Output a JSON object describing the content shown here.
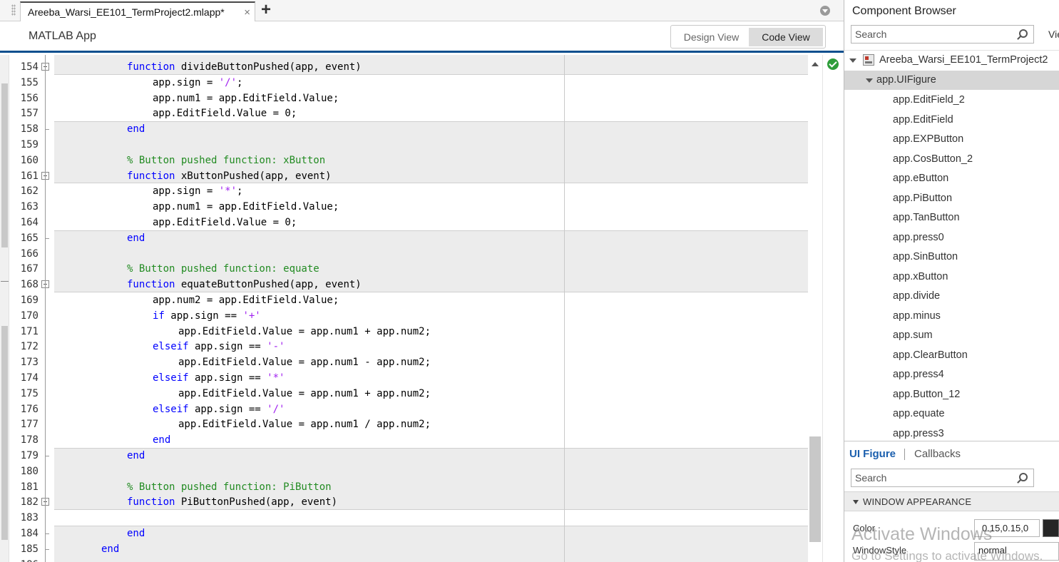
{
  "editor_tab": {
    "file_name": "Areeba_Warsi_EE101_TermProject2.mlapp*",
    "close_glyph": "×",
    "add_glyph": "+"
  },
  "app_header": {
    "title": "MATLAB App",
    "design_view_label": "Design View",
    "code_view_label": "Code View"
  },
  "code_lines": [
    {
      "n": "154",
      "indent": 8,
      "tokens": [
        [
          "kw",
          "function"
        ],
        [
          "",
          "divideButtonPushed(app, event)"
        ]
      ],
      "fold": "start"
    },
    {
      "n": "155",
      "indent": 12,
      "tokens": [
        [
          "",
          "app.sign = "
        ],
        [
          "st",
          "'/'"
        ],
        [
          "",
          ";"
        ]
      ]
    },
    {
      "n": "156",
      "indent": 12,
      "tokens": [
        [
          "",
          "app.num1 = app.EditField.Value;"
        ]
      ]
    },
    {
      "n": "157",
      "indent": 12,
      "tokens": [
        [
          "",
          "app.EditField.Value = 0;"
        ]
      ]
    },
    {
      "n": "158",
      "indent": 8,
      "tokens": [
        [
          "kw",
          "end"
        ]
      ],
      "fold": "end"
    },
    {
      "n": "159",
      "indent": 0,
      "tokens": []
    },
    {
      "n": "160",
      "indent": 8,
      "tokens": [
        [
          "cm",
          "% Button pushed function: xButton"
        ]
      ]
    },
    {
      "n": "161",
      "indent": 8,
      "tokens": [
        [
          "kw",
          "function"
        ],
        [
          "",
          "xButtonPushed(app, event)"
        ]
      ],
      "fold": "start"
    },
    {
      "n": "162",
      "indent": 12,
      "tokens": [
        [
          "",
          "app.sign = "
        ],
        [
          "st",
          "'*'"
        ],
        [
          "",
          ";"
        ]
      ]
    },
    {
      "n": "163",
      "indent": 12,
      "tokens": [
        [
          "",
          "app.num1 = app.EditField.Value;"
        ]
      ]
    },
    {
      "n": "164",
      "indent": 12,
      "tokens": [
        [
          "",
          "app.EditField.Value = 0;"
        ]
      ]
    },
    {
      "n": "165",
      "indent": 8,
      "tokens": [
        [
          "kw",
          "end"
        ]
      ],
      "fold": "end"
    },
    {
      "n": "166",
      "indent": 0,
      "tokens": []
    },
    {
      "n": "167",
      "indent": 8,
      "tokens": [
        [
          "cm",
          "% Button pushed function: equate"
        ]
      ]
    },
    {
      "n": "168",
      "indent": 8,
      "tokens": [
        [
          "kw",
          "function"
        ],
        [
          "",
          "equateButtonPushed(app, event)"
        ]
      ],
      "fold": "start"
    },
    {
      "n": "169",
      "indent": 12,
      "tokens": [
        [
          "",
          "app.num2 = app.EditField.Value;"
        ]
      ]
    },
    {
      "n": "170",
      "indent": 12,
      "tokens": [
        [
          "kw",
          "if"
        ],
        [
          "",
          "app.sign == "
        ],
        [
          "st",
          "'+'"
        ]
      ]
    },
    {
      "n": "171",
      "indent": 16,
      "tokens": [
        [
          "",
          "app.EditField.Value = app.num1 + app.num2;"
        ]
      ]
    },
    {
      "n": "172",
      "indent": 12,
      "tokens": [
        [
          "kw",
          "elseif"
        ],
        [
          "",
          "app.sign == "
        ],
        [
          "st",
          "'-'"
        ]
      ]
    },
    {
      "n": "173",
      "indent": 16,
      "tokens": [
        [
          "",
          "app.EditField.Value = app.num1 - app.num2;"
        ]
      ]
    },
    {
      "n": "174",
      "indent": 12,
      "tokens": [
        [
          "kw",
          "elseif"
        ],
        [
          "",
          "app.sign == "
        ],
        [
          "st",
          "'*'"
        ]
      ]
    },
    {
      "n": "175",
      "indent": 16,
      "tokens": [
        [
          "",
          "app.EditField.Value = app.num1 + app.num2;"
        ]
      ]
    },
    {
      "n": "176",
      "indent": 12,
      "tokens": [
        [
          "kw",
          "elseif"
        ],
        [
          "",
          "app.sign == "
        ],
        [
          "st",
          "'/'"
        ]
      ]
    },
    {
      "n": "177",
      "indent": 16,
      "tokens": [
        [
          "",
          "app.EditField.Value = app.num1 / app.num2;"
        ]
      ]
    },
    {
      "n": "178",
      "indent": 12,
      "tokens": [
        [
          "kw",
          "end"
        ]
      ]
    },
    {
      "n": "179",
      "indent": 8,
      "tokens": [
        [
          "kw",
          "end"
        ]
      ],
      "fold": "end"
    },
    {
      "n": "180",
      "indent": 0,
      "tokens": []
    },
    {
      "n": "181",
      "indent": 8,
      "tokens": [
        [
          "cm",
          "% Button pushed function: PiButton"
        ]
      ]
    },
    {
      "n": "182",
      "indent": 8,
      "tokens": [
        [
          "kw",
          "function"
        ],
        [
          "",
          "PiButtonPushed(app, event)"
        ]
      ],
      "fold": "start"
    },
    {
      "n": "183",
      "indent": 0,
      "tokens": []
    },
    {
      "n": "184",
      "indent": 8,
      "tokens": [
        [
          "kw",
          "end"
        ]
      ],
      "fold": "end"
    },
    {
      "n": "185",
      "indent": 4,
      "tokens": [
        [
          "kw",
          "end"
        ]
      ],
      "fold": "end"
    },
    {
      "n": "186",
      "indent": 0,
      "tokens": []
    }
  ],
  "component_browser": {
    "title": "Component Browser",
    "search_placeholder": "Search",
    "view_cut_label": "Vie",
    "root": "Areeba_Warsi_EE101_TermProject2",
    "figure": "app.UIFigure",
    "components": [
      "app.EditField_2",
      "app.EditField",
      "app.EXPButton",
      "app.CosButton_2",
      "app.eButton",
      "app.PiButton",
      "app.TanButton",
      "app.press0",
      "app.SinButton",
      "app.xButton",
      "app.divide",
      "app.minus",
      "app.sum",
      "app.ClearButton",
      "app.press4",
      "app.Button_12",
      "app.equate",
      "app.press3"
    ]
  },
  "inspector": {
    "tab_ui_figure": "UI Figure",
    "tab_callbacks": "Callbacks",
    "search_placeholder": "Search",
    "section_title": "WINDOW APPEARANCE",
    "color_label": "Color",
    "color_value": "0.15,0.15,0",
    "color_swatch": "#262626",
    "window_style_label": "WindowStyle",
    "window_style_value": "normal"
  },
  "watermark": {
    "line1": "Activate Windows",
    "line2": "Go to Settings to activate Windows."
  }
}
